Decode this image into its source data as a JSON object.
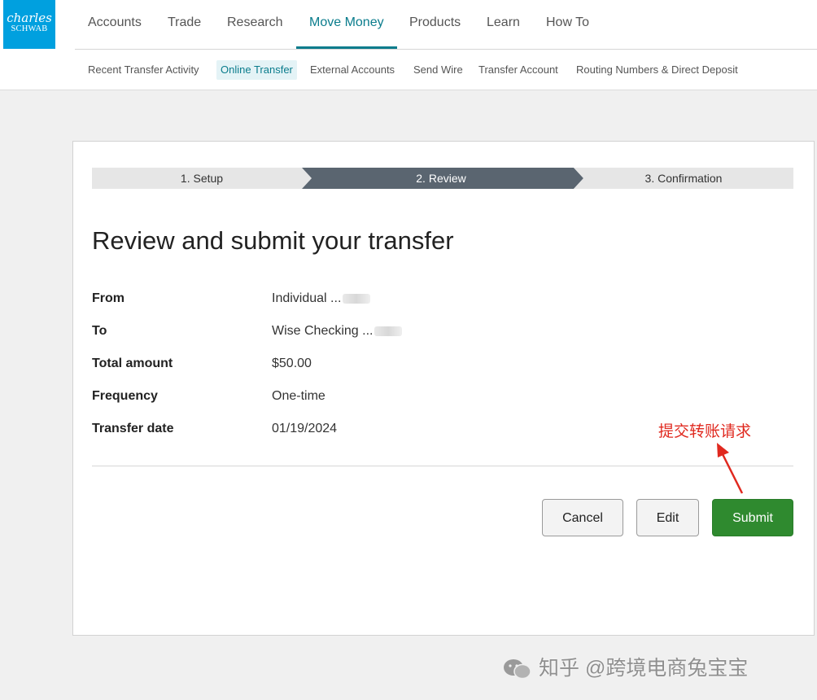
{
  "logo": {
    "line1": "charles",
    "line2": "SCHWAB"
  },
  "main_nav": [
    {
      "label": "Accounts"
    },
    {
      "label": "Trade"
    },
    {
      "label": "Research"
    },
    {
      "label": "Move Money",
      "active": true
    },
    {
      "label": "Products"
    },
    {
      "label": "Learn"
    },
    {
      "label": "How To"
    }
  ],
  "sub_nav": [
    {
      "label": "Recent Transfer Activity"
    },
    {
      "label": "Online Transfer",
      "active": true
    },
    {
      "label": "External Accounts"
    },
    {
      "label": "Send Wire"
    },
    {
      "label": "Transfer Account"
    },
    {
      "label": "Routing Numbers & Direct Deposit"
    }
  ],
  "steps": [
    {
      "label": "1. Setup"
    },
    {
      "label": "2. Review",
      "active": true
    },
    {
      "label": "3. Confirmation"
    }
  ],
  "page_title": "Review and submit your transfer",
  "details": [
    {
      "label": "From",
      "value": "Individual ...",
      "masked": true
    },
    {
      "label": "To",
      "value": "Wise Checking ...",
      "masked": true
    },
    {
      "label": "Total amount",
      "value": "$50.00"
    },
    {
      "label": "Frequency",
      "value": "One-time"
    },
    {
      "label": "Transfer date",
      "value": "01/19/2024"
    }
  ],
  "buttons": {
    "cancel": "Cancel",
    "edit": "Edit",
    "submit": "Submit"
  },
  "annotation": "提交转账请求",
  "watermark": "知乎 @跨境电商兔宝宝",
  "colors": {
    "brand": "#00a0df",
    "active_nav": "#0a7c8c",
    "step_active": "#5a6570",
    "submit": "#2f8a2f",
    "annotation": "#e0291f"
  }
}
